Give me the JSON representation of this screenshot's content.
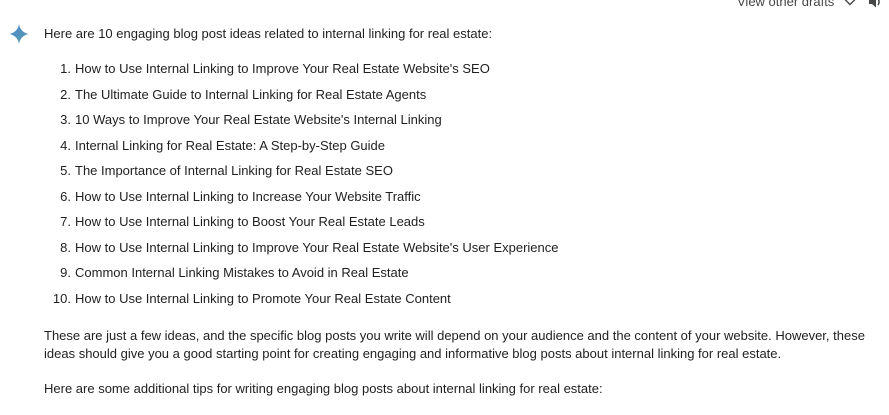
{
  "header": {
    "drafts_label": "View other drafts",
    "chevron_icon": "chevron-down-icon",
    "speaker_icon": "volume-icon"
  },
  "response": {
    "avatar_icon": "sparkle-icon",
    "intro": "Here are 10 engaging blog post ideas related to internal linking for real estate:",
    "ideas": [
      {
        "num": "1.",
        "text": "How to Use Internal Linking to Improve Your Real Estate Website's SEO"
      },
      {
        "num": "2.",
        "text": "The Ultimate Guide to Internal Linking for Real Estate Agents"
      },
      {
        "num": "3.",
        "text": "10 Ways to Improve Your Real Estate Website's Internal Linking"
      },
      {
        "num": "4.",
        "text": "Internal Linking for Real Estate: A Step-by-Step Guide"
      },
      {
        "num": "5.",
        "text": "The Importance of Internal Linking for Real Estate SEO"
      },
      {
        "num": "6.",
        "text": "How to Use Internal Linking to Increase Your Website Traffic"
      },
      {
        "num": "7.",
        "text": "How to Use Internal Linking to Boost Your Real Estate Leads"
      },
      {
        "num": "8.",
        "text": "How to Use Internal Linking to Improve Your Real Estate Website's User Experience"
      },
      {
        "num": "9.",
        "text": "Common Internal Linking Mistakes to Avoid in Real Estate"
      },
      {
        "num": "10.",
        "text": "How to Use Internal Linking to Promote Your Real Estate Content"
      }
    ],
    "paragraph_1": "These are just a few ideas, and the specific blog posts you write will depend on your audience and the content of your website. However, these ideas should give you a good starting point for creating engaging and informative blog posts about internal linking for real estate.",
    "paragraph_2": "Here are some additional tips for writing engaging blog posts about internal linking for real estate:"
  },
  "colors": {
    "text": "#1f1f1f",
    "muted": "#444746",
    "sparkle_blue": "#4a89dc",
    "sparkle_teal": "#5b9aa0"
  }
}
